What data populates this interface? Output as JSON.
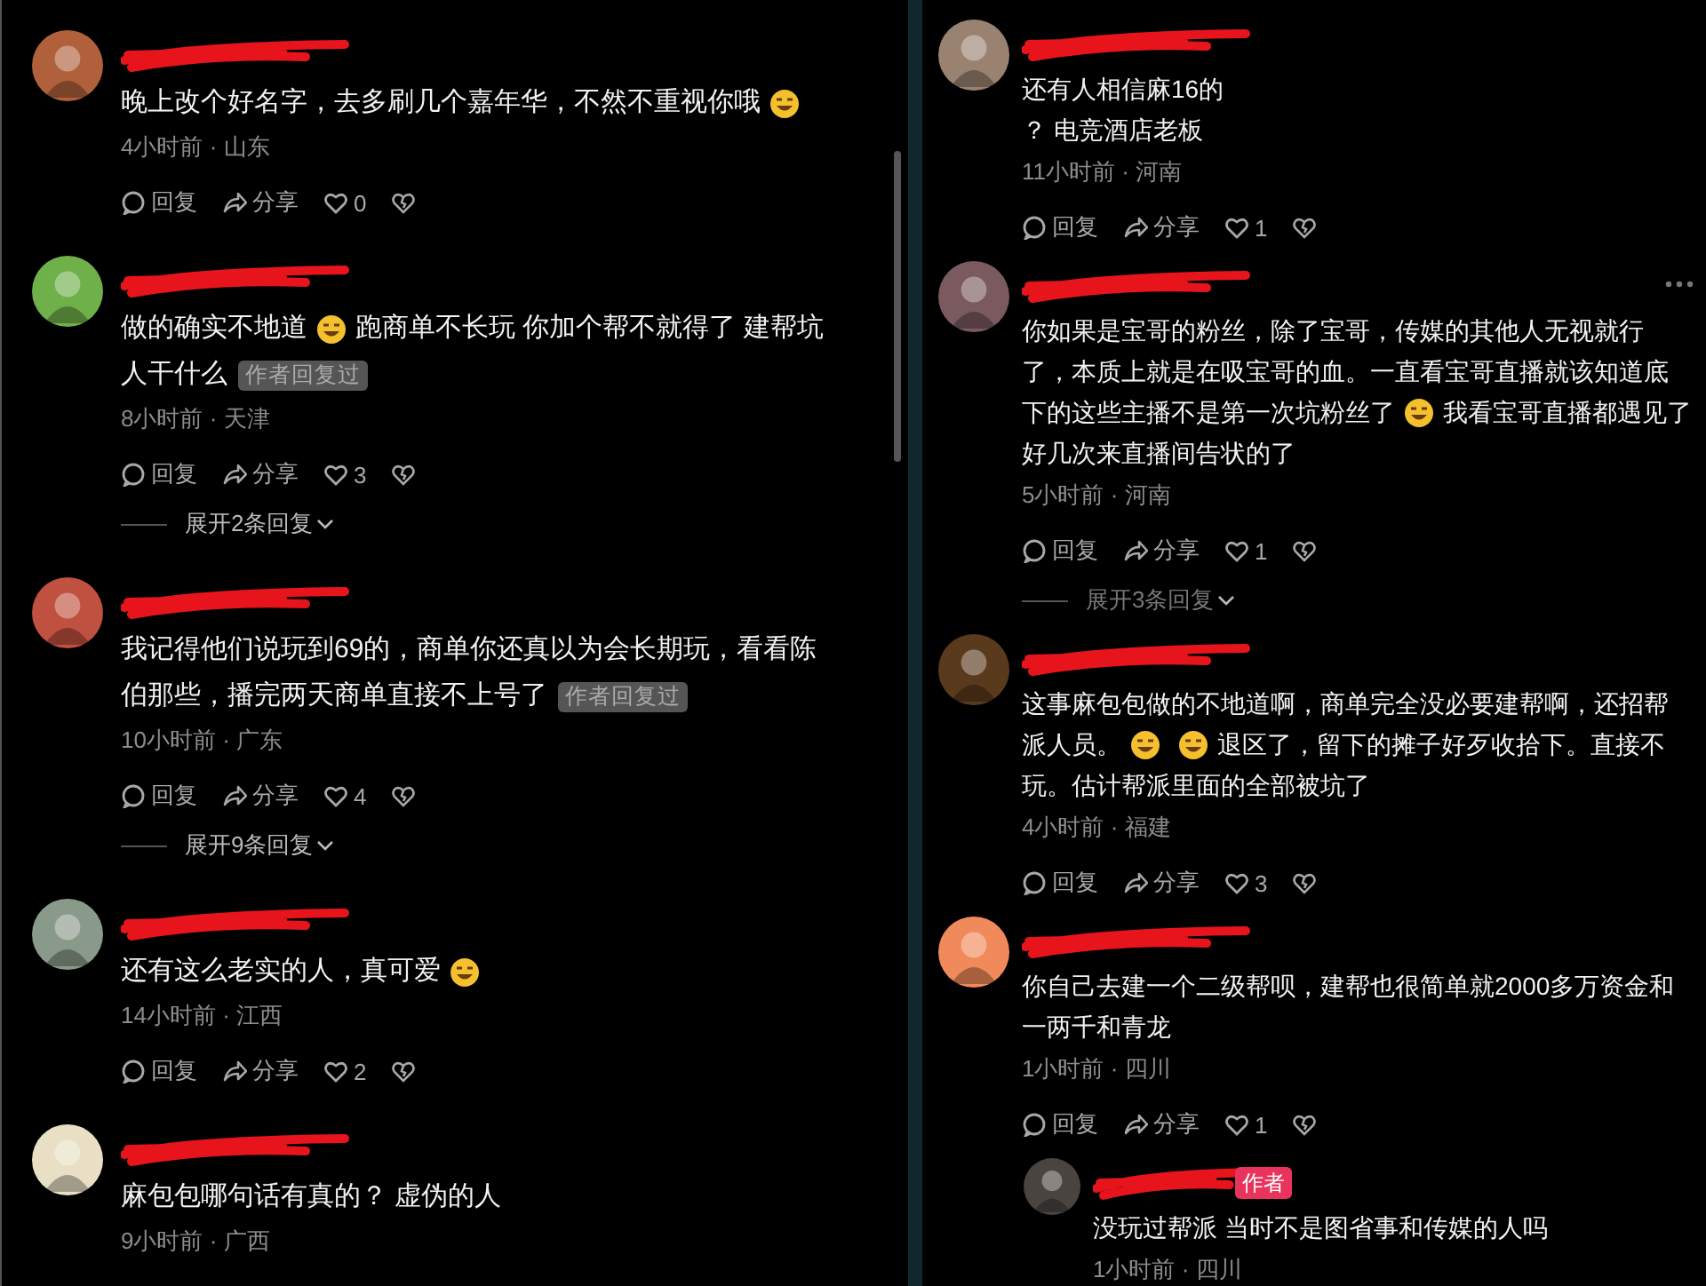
{
  "panels": [
    {
      "scrollbar_shown": true,
      "comments": [
        {
          "avatar": {
            "color": "#b0603a"
          },
          "name_redacted": true,
          "lines": [
            [
              {
                "kind": "text",
                "text": "晚上改个好名字，去多刷几个嘉年华，不然不重视你哦"
              },
              {
                "kind": "emoji"
              }
            ]
          ],
          "meta": "4小时前 · 山东",
          "actions": {
            "reply": "回复",
            "share": "分享",
            "likes": "0"
          }
        },
        {
          "avatar": {
            "color": "#6fb04a"
          },
          "name_redacted": true,
          "lines": [
            [
              {
                "kind": "text",
                "text": "做的确实不地道"
              },
              {
                "kind": "emoji"
              },
              {
                "kind": "text",
                "text": "跑商单不长玩 你加个帮不就得了 建帮坑"
              }
            ],
            [
              {
                "kind": "text",
                "text": "人干什么"
              },
              {
                "kind": "badge",
                "text": "作者回复过"
              }
            ]
          ],
          "meta": "8小时前 · 天津",
          "actions": {
            "reply": "回复",
            "share": "分享",
            "likes": "3"
          },
          "expand": "展开2条回复"
        },
        {
          "avatar": {
            "color": "#c0503f"
          },
          "name_redacted": true,
          "lines": [
            [
              {
                "kind": "text",
                "text": "我记得他们说玩到69的，商单你还真以为会长期玩，看看陈"
              }
            ],
            [
              {
                "kind": "text",
                "text": "伯那些，播完两天商单直接不上号了"
              },
              {
                "kind": "badge",
                "text": "作者回复过"
              }
            ]
          ],
          "meta": "10小时前 · 广东",
          "actions": {
            "reply": "回复",
            "share": "分享",
            "likes": "4"
          },
          "expand": "展开9条回复"
        },
        {
          "avatar": {
            "color": "#8a9a8a"
          },
          "name_redacted": true,
          "lines": [
            [
              {
                "kind": "text",
                "text": "还有这么老实的人，真可爱"
              },
              {
                "kind": "emoji"
              }
            ]
          ],
          "meta": "14小时前 · 江西",
          "actions": {
            "reply": "回复",
            "share": "分享",
            "likes": "2"
          }
        },
        {
          "avatar": {
            "color": "#e8dfc4"
          },
          "name_redacted": true,
          "lines": [
            [
              {
                "kind": "text",
                "text": "麻包包哪句话有真的？ 虚伪的人"
              }
            ]
          ],
          "meta": "9小时前 · 广西"
        }
      ]
    },
    {
      "scrollbar_shown": false,
      "comments": [
        {
          "avatar": {
            "color": "#9a8270"
          },
          "name_redacted": true,
          "lines": [
            [
              {
                "kind": "text",
                "text": "还有人相信麻16的"
              }
            ],
            [
              {
                "kind": "text",
                "text": "？ 电竞酒店老板"
              }
            ]
          ],
          "meta": "11小时前 · 河南",
          "actions": {
            "reply": "回复",
            "share": "分享",
            "likes": "1"
          }
        },
        {
          "avatar": {
            "color": "#7a5a5e"
          },
          "name_redacted": true,
          "more_button": true,
          "lines": [
            [
              {
                "kind": "text",
                "text": "你如果是宝哥的粉丝，除了宝哥，传媒的其他人无视就行"
              }
            ],
            [
              {
                "kind": "text",
                "text": "了，本质上就是在吸宝哥的血。一直看宝哥直播就该知道底"
              }
            ],
            [
              {
                "kind": "text",
                "text": "下的这些主播不是第一次坑粉丝了"
              },
              {
                "kind": "emoji"
              },
              {
                "kind": "text",
                "text": "我看宝哥直播都遇见了"
              }
            ],
            [
              {
                "kind": "text",
                "text": "好几次来直播间告状的了"
              }
            ]
          ],
          "meta": "5小时前 · 河南",
          "actions": {
            "reply": "回复",
            "share": "分享",
            "likes": "1"
          },
          "expand": "展开3条回复"
        },
        {
          "avatar": {
            "color": "#5a3a1c"
          },
          "name_redacted": true,
          "lines": [
            [
              {
                "kind": "text",
                "text": "这事麻包包做的不地道啊，商单完全没必要建帮啊，还招帮"
              }
            ],
            [
              {
                "kind": "text",
                "text": "派人员。"
              },
              {
                "kind": "emoji"
              },
              {
                "kind": "emoji"
              },
              {
                "kind": "text",
                "text": "退区了，留下的摊子好歹收拾下。直接不"
              }
            ],
            [
              {
                "kind": "text",
                "text": "玩。估计帮派里面的全部被坑了"
              }
            ]
          ],
          "meta": "4小时前 · 福建",
          "actions": {
            "reply": "回复",
            "share": "分享",
            "likes": "3"
          }
        },
        {
          "avatar": {
            "color": "#f08a5a"
          },
          "name_redacted": true,
          "lines": [
            [
              {
                "kind": "text",
                "text": "你自己去建一个二级帮呗，建帮也很简单就2000多万资金和"
              }
            ],
            [
              {
                "kind": "text",
                "text": "一两千和青龙"
              }
            ]
          ],
          "meta": "1小时前 · 四川",
          "actions": {
            "reply": "回复",
            "share": "分享",
            "likes": "1"
          },
          "replies": [
            {
              "avatar": {
                "color": "#4a4440"
              },
              "name_redacted": true,
              "author_badge": "作者",
              "lines": [
                [
                  {
                    "kind": "text",
                    "text": "没玩过帮派 当时不是图省事和传媒的人吗"
                  }
                ]
              ],
              "meta": "1小时前 · 四川"
            }
          ]
        }
      ]
    }
  ]
}
